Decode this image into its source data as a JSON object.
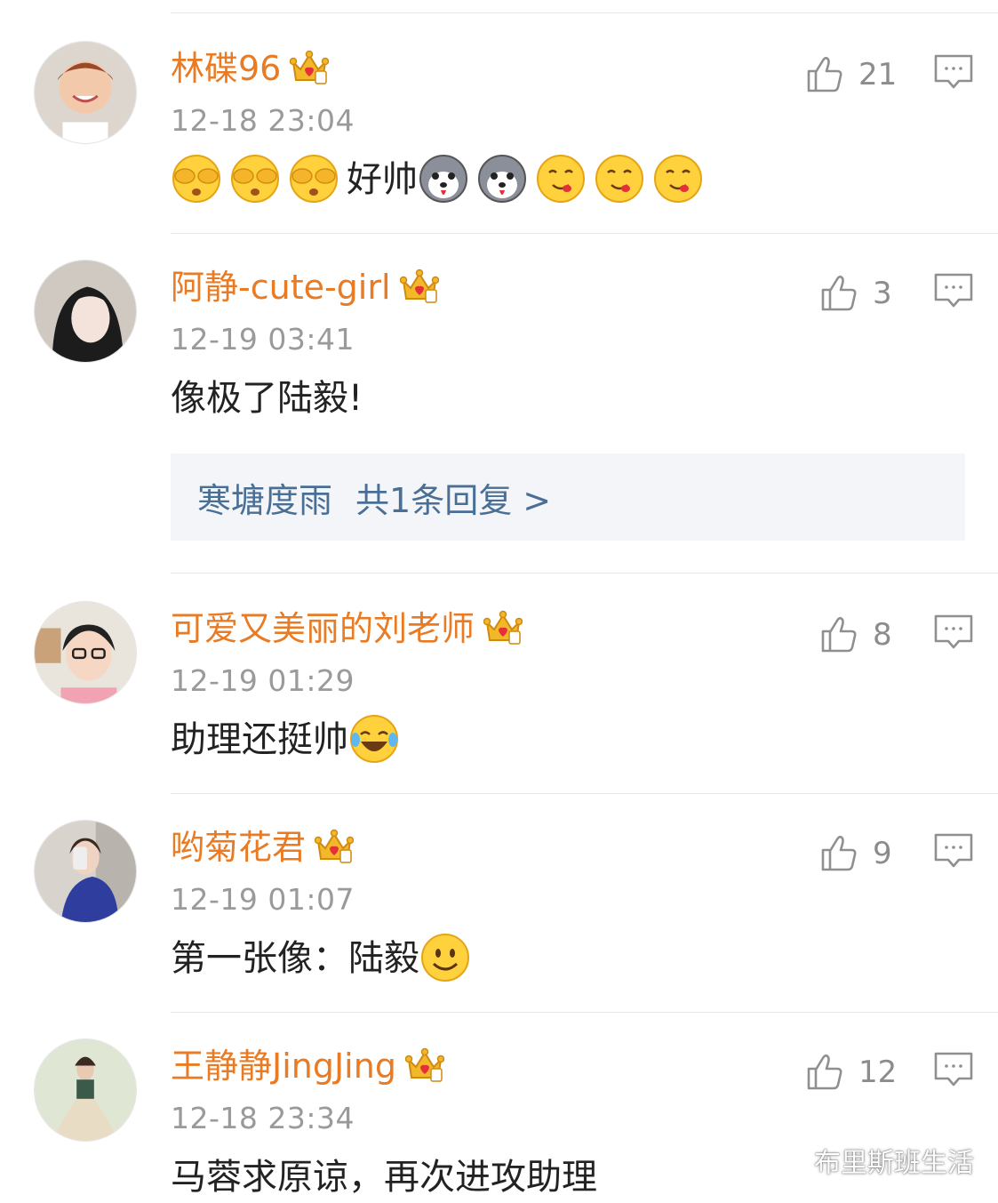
{
  "comments": [
    {
      "username": "林碟96",
      "time": "12-18 23:04",
      "likes": "21",
      "text_before": "",
      "text_middle": "好帅",
      "text_after": "",
      "emojis_before": [
        "cover-eyes-emoji",
        "cover-eyes-emoji",
        "cover-eyes-emoji"
      ],
      "emojis_after": [
        "husky-emoji",
        "husky-emoji",
        "drool-emoji",
        "drool-emoji",
        "drool-emoji"
      ]
    },
    {
      "username": "阿静-cute-girl",
      "time": "12-19 03:41",
      "likes": "3",
      "text": "像极了陆毅!",
      "reply": {
        "author": "寒塘度雨",
        "summary": "共1条回复 >"
      }
    },
    {
      "username": "可爱又美丽的刘老师",
      "time": "12-19 01:29",
      "likes": "8",
      "text": "助理还挺帅",
      "emoji": "laugh-cry-emoji"
    },
    {
      "username": "哟菊花君",
      "time": "12-19 01:07",
      "likes": "9",
      "text": "第一张像：陆毅",
      "emoji": "smile-emoji"
    },
    {
      "username": "王静静JingJing",
      "time": "12-18 23:34",
      "likes": "12",
      "text": "马蓉求原谅，再次进攻助理"
    }
  ],
  "watermark": "布里斯班生活",
  "colors": {
    "username": "#e97b24",
    "timestamp": "#9a9a9a",
    "reply_link": "#4a6f96",
    "reply_bg": "#f3f5f8"
  }
}
